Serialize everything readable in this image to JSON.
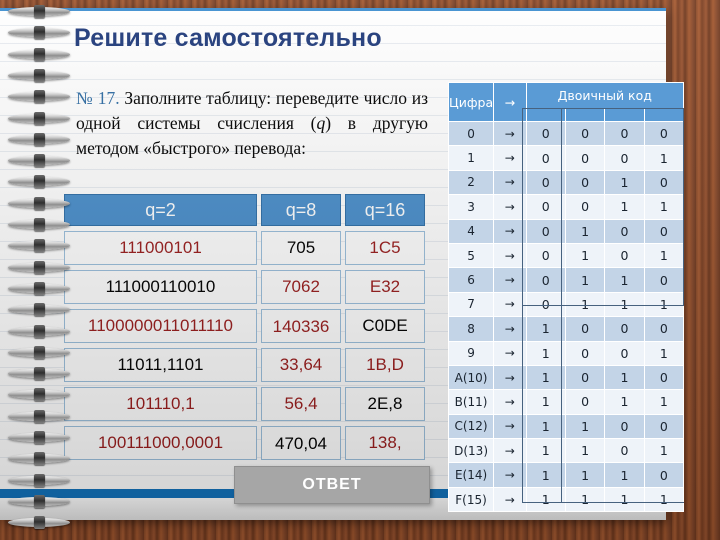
{
  "slide": {
    "title": "Решите самостоятельно",
    "task_number": "№ 17.",
    "task_text": "Заполните таблицу: переведите число из одной системы счисления (",
    "task_var": "q",
    "task_text2": ") в другую методом «быстрого» перевода:",
    "answer_button": "ОТВЕТ"
  },
  "colors": {
    "title": "#1f3a7a",
    "header_blue": "#4a8fcc",
    "table_blue": "#5a9bd5",
    "red_value": "#9b1c1c",
    "black_value": "#000000",
    "button_gray": "#a6a6a6",
    "bottom_bar": "#1273bd",
    "wood": "#8a4a28"
  },
  "conversion_table": {
    "headers": [
      "q=2",
      "q=8",
      "q=16"
    ],
    "rows": [
      {
        "q2": "111000101",
        "q2_color": "red",
        "q8": "705",
        "q8_color": "black",
        "q16": "1C5",
        "q16_color": "red"
      },
      {
        "q2": "111000110010",
        "q2_color": "black",
        "q8": "7062",
        "q8_color": "red",
        "q16": "E32",
        "q16_color": "red"
      },
      {
        "q2": "1100000011011110",
        "q2_color": "red",
        "q8": "140336",
        "q8_color": "red",
        "q16": "C0DE",
        "q16_color": "black"
      },
      {
        "q2": "11011,1101",
        "q2_color": "black",
        "q8": "33,64",
        "q8_color": "red",
        "q16": "1B,D",
        "q16_color": "red"
      },
      {
        "q2": "101110,1",
        "q2_color": "red",
        "q8": "56,4",
        "q8_color": "red",
        "q16": "2E,8",
        "q16_color": "black"
      },
      {
        "q2": "100111000,0001",
        "q2_color": "red",
        "q8": "470,04",
        "q8_color": "black",
        "q16": "138,",
        "q16_color": "red"
      }
    ]
  },
  "binary_table": {
    "header_digit": "Цифра",
    "header_arrow": "→",
    "header_code": "Двоичный код",
    "arrow": "→",
    "rows": [
      {
        "digit": "0",
        "bits": [
          "0",
          "0",
          "0",
          "0"
        ]
      },
      {
        "digit": "1",
        "bits": [
          "0",
          "0",
          "0",
          "1"
        ]
      },
      {
        "digit": "2",
        "bits": [
          "0",
          "0",
          "1",
          "0"
        ]
      },
      {
        "digit": "3",
        "bits": [
          "0",
          "0",
          "1",
          "1"
        ]
      },
      {
        "digit": "4",
        "bits": [
          "0",
          "1",
          "0",
          "0"
        ]
      },
      {
        "digit": "5",
        "bits": [
          "0",
          "1",
          "0",
          "1"
        ]
      },
      {
        "digit": "6",
        "bits": [
          "0",
          "1",
          "1",
          "0"
        ]
      },
      {
        "digit": "7",
        "bits": [
          "0",
          "1",
          "1",
          "1"
        ]
      },
      {
        "digit": "8",
        "bits": [
          "1",
          "0",
          "0",
          "0"
        ]
      },
      {
        "digit": "9",
        "bits": [
          "1",
          "0",
          "0",
          "1"
        ]
      },
      {
        "digit": "A(10)",
        "bits": [
          "1",
          "0",
          "1",
          "0"
        ]
      },
      {
        "digit": "B(11)",
        "bits": [
          "1",
          "0",
          "1",
          "1"
        ]
      },
      {
        "digit": "C(12)",
        "bits": [
          "1",
          "1",
          "0",
          "0"
        ]
      },
      {
        "digit": "D(13)",
        "bits": [
          "1",
          "1",
          "0",
          "1"
        ]
      },
      {
        "digit": "E(14)",
        "bits": [
          "1",
          "1",
          "1",
          "0"
        ]
      },
      {
        "digit": "F(15)",
        "bits": [
          "1",
          "1",
          "1",
          "1"
        ]
      }
    ]
  }
}
